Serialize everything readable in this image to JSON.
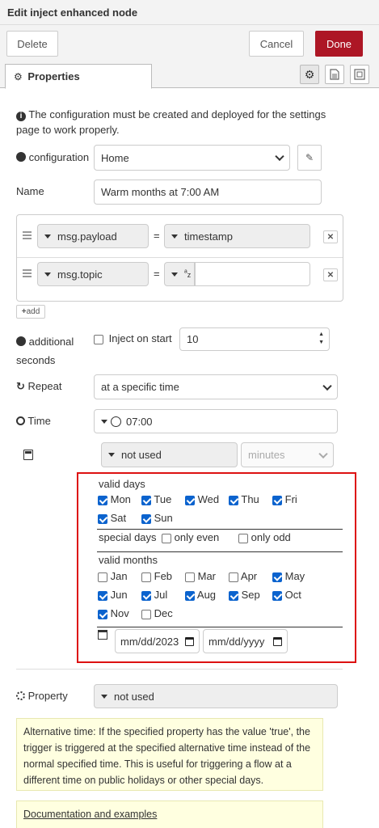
{
  "title": "Edit inject enhanced node",
  "toolbar": {
    "delete": "Delete",
    "cancel": "Cancel",
    "done": "Done"
  },
  "tabs": {
    "properties": "Properties"
  },
  "info": "The configuration must be created and deployed for the settings page to work properly.",
  "configuration": {
    "label": "configuration",
    "value": "Home"
  },
  "name": {
    "label": "Name",
    "value": "Warm months at 7:00 AM"
  },
  "props": [
    {
      "name": "msg.payload",
      "eq": "=",
      "value": "timestamp"
    },
    {
      "name": "msg.topic",
      "eq": "=",
      "value": ""
    }
  ],
  "add": "add",
  "additional": {
    "label_a": "additional",
    "label_b": "seconds",
    "inject_on_start": "Inject on start",
    "value": "10"
  },
  "repeat": {
    "label": "Repeat",
    "value": "at a specific time"
  },
  "time": {
    "label": "Time",
    "value": "07:00"
  },
  "offset": {
    "value": "not used",
    "unit": "minutes"
  },
  "valid_days": {
    "label": "valid days",
    "days": [
      {
        "name": "Mon",
        "checked": true
      },
      {
        "name": "Tue",
        "checked": true
      },
      {
        "name": "Wed",
        "checked": true
      },
      {
        "name": "Thu",
        "checked": true
      },
      {
        "name": "Fri",
        "checked": true
      },
      {
        "name": "Sat",
        "checked": true
      },
      {
        "name": "Sun",
        "checked": true
      }
    ]
  },
  "special_days": {
    "label": "special days",
    "even": "only even",
    "odd": "only odd"
  },
  "valid_months": {
    "label": "valid months",
    "months": [
      {
        "name": "Jan",
        "checked": false
      },
      {
        "name": "Feb",
        "checked": false
      },
      {
        "name": "Mar",
        "checked": false
      },
      {
        "name": "Apr",
        "checked": false
      },
      {
        "name": "May",
        "checked": true
      },
      {
        "name": "Jun",
        "checked": true
      },
      {
        "name": "Jul",
        "checked": true
      },
      {
        "name": "Aug",
        "checked": true
      },
      {
        "name": "Sep",
        "checked": true
      },
      {
        "name": "Oct",
        "checked": true
      },
      {
        "name": "Nov",
        "checked": true
      },
      {
        "name": "Dec",
        "checked": false
      }
    ]
  },
  "dates": {
    "from": "mm/dd/2023",
    "to": "mm/dd/yyyy"
  },
  "property": {
    "label": "Property",
    "value": "not used"
  },
  "alt_note": "Alternative time: If the specified property has the value 'true', the trigger is triggered at the specified alternative time instead of the normal specified time. This is useful for triggering a flow at a different time on public holidays or other special days.",
  "doc_link": "Documentation and examples",
  "colors": {
    "done": "#ad1625",
    "highlight": "#dd1111",
    "checkbox": "#0b63ce"
  }
}
